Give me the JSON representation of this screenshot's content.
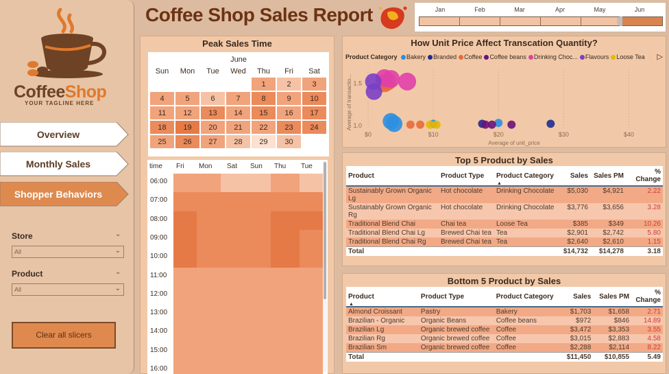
{
  "app": {
    "title": "Coffee Shop Sales Report",
    "logo_word1": "Coffee",
    "logo_word2": "Shop",
    "tagline": "YOUR TAGLINE HERE"
  },
  "nav": [
    {
      "label": "Overview",
      "active": false
    },
    {
      "label": "Monthly Sales",
      "active": false
    },
    {
      "label": "Shopper Behaviors",
      "active": true
    }
  ],
  "slicers": {
    "store_label": "Store",
    "store_value": "All",
    "product_label": "Product",
    "product_value": "All",
    "clear_label": "Clear all slicers"
  },
  "months": {
    "labels": [
      "Jan",
      "Feb",
      "Mar",
      "Apr",
      "May",
      "Jun"
    ],
    "selected": "Jun"
  },
  "peak": {
    "title": "Peak Sales Time",
    "month": "June",
    "dow": [
      "Sun",
      "Mon",
      "Tue",
      "Wed",
      "Thu",
      "Fri",
      "Sat"
    ],
    "days": [
      {
        "d": "1",
        "level": 2
      },
      {
        "d": "2",
        "level": 1
      },
      {
        "d": "3",
        "level": 2
      },
      {
        "d": "4",
        "level": 2
      },
      {
        "d": "5",
        "level": 2
      },
      {
        "d": "6",
        "level": 1
      },
      {
        "d": "7",
        "level": 2
      },
      {
        "d": "8",
        "level": 3
      },
      {
        "d": "9",
        "level": 2
      },
      {
        "d": "10",
        "level": 3
      },
      {
        "d": "11",
        "level": 2
      },
      {
        "d": "12",
        "level": 2
      },
      {
        "d": "13",
        "level": 3
      },
      {
        "d": "14",
        "level": 2
      },
      {
        "d": "15",
        "level": 3
      },
      {
        "d": "16",
        "level": 2
      },
      {
        "d": "17",
        "level": 3
      },
      {
        "d": "18",
        "level": 3
      },
      {
        "d": "19",
        "level": 4
      },
      {
        "d": "20",
        "level": 2
      },
      {
        "d": "21",
        "level": 2
      },
      {
        "d": "22",
        "level": 2
      },
      {
        "d": "23",
        "level": 3
      },
      {
        "d": "24",
        "level": 3
      },
      {
        "d": "25",
        "level": 2
      },
      {
        "d": "26",
        "level": 3
      },
      {
        "d": "27",
        "level": 2
      },
      {
        "d": "28",
        "level": 1
      },
      {
        "d": "29",
        "level": 0
      },
      {
        "d": "30",
        "level": 1
      }
    ],
    "heat_header": [
      "time",
      "Fri",
      "Mon",
      "Sat",
      "Sun",
      "Thu",
      "Tue"
    ],
    "times": [
      "06:00",
      "07:00",
      "08:00",
      "09:00",
      "10:00",
      "11:00",
      "12:00",
      "13:00",
      "14:00",
      "15:00",
      "16:00"
    ],
    "heat_levels": [
      [
        2,
        2,
        1,
        1,
        2,
        1
      ],
      [
        3,
        3,
        3,
        3,
        3,
        3
      ],
      [
        4,
        3,
        3,
        3,
        4,
        4
      ],
      [
        4,
        3,
        3,
        3,
        4,
        3
      ],
      [
        4,
        3,
        3,
        3,
        4,
        3
      ],
      [
        2,
        2,
        2,
        2,
        2,
        2
      ],
      [
        2,
        2,
        2,
        2,
        2,
        2
      ],
      [
        2,
        2,
        2,
        2,
        2,
        2
      ],
      [
        2,
        2,
        2,
        2,
        2,
        2
      ],
      [
        2,
        2,
        2,
        2,
        2,
        2
      ],
      [
        2,
        2,
        2,
        2,
        2,
        2
      ]
    ],
    "heat_colors": [
      "#fde0cf",
      "#f6c2a5",
      "#f1a37b",
      "#eb8a5b",
      "#e57a46"
    ]
  },
  "scatter": {
    "title": "How Unit Price Affect Transcation Quantity?",
    "legend_title": "Product Category",
    "legend": [
      {
        "name": "Bakery",
        "color": "#2d8fe0"
      },
      {
        "name": "Branded",
        "color": "#1f2d8f"
      },
      {
        "name": "Coffee",
        "color": "#e86a3a"
      },
      {
        "name": "Coffee beans",
        "color": "#6b127a"
      },
      {
        "name": "Drinking Choc...",
        "color": "#e040a8"
      },
      {
        "name": "Flavours",
        "color": "#7a3fc8"
      },
      {
        "name": "Loose Tea",
        "color": "#e6b800"
      }
    ],
    "ylabel": "Average of transactio...",
    "xlabel": "Average of unit_price",
    "xticks": [
      "$0",
      "$10",
      "$20",
      "$30",
      "$40"
    ],
    "yticks": [
      "1.5",
      "1.0"
    ]
  },
  "chart_data": {
    "type": "scatter",
    "title": "How Unit Price Affect Transcation Quantity?",
    "xlabel": "Average of unit_price",
    "ylabel": "Average of transactio...",
    "xlim": [
      0,
      45
    ],
    "ylim": [
      0.95,
      1.6
    ],
    "series": [
      {
        "name": "Bakery",
        "points": [
          [
            3.5,
            1.05
          ],
          [
            4,
            1.02
          ],
          [
            10,
            1.02
          ],
          [
            20,
            1.03
          ]
        ]
      },
      {
        "name": "Branded",
        "points": [
          [
            17.5,
            1.02
          ],
          [
            28,
            1.02
          ]
        ]
      },
      {
        "name": "Coffee",
        "points": [
          [
            3,
            1.52
          ],
          [
            2.5,
            1.5
          ],
          [
            6.5,
            1.01
          ],
          [
            8,
            1.01
          ]
        ]
      },
      {
        "name": "Coffee beans",
        "points": [
          [
            18,
            1.01
          ],
          [
            22,
            1.01
          ],
          [
            19,
            1.01
          ]
        ]
      },
      {
        "name": "Drinking Choc...",
        "points": [
          [
            3.5,
            1.55
          ],
          [
            6,
            1.52
          ],
          [
            2.5,
            1.56
          ]
        ]
      },
      {
        "name": "Flavours",
        "points": [
          [
            0.8,
            1.52
          ],
          [
            0.9,
            1.4
          ]
        ]
      },
      {
        "name": "Loose Tea",
        "points": [
          [
            9.5,
            1.01
          ],
          [
            10.5,
            1.01
          ]
        ]
      }
    ]
  },
  "top5": {
    "title": "Top 5 Product by Sales",
    "headers": [
      "Product",
      "Product Type",
      "Product Category",
      "Sales",
      "Sales PM",
      "% Change"
    ],
    "rows": [
      [
        "Sustainably Grown Organic Lg",
        "Hot chocolate",
        "Drinking Chocolate",
        "$5,030",
        "$4,921",
        "2.22"
      ],
      [
        "Sustainably Grown Organic Rg",
        "Hot chocolate",
        "Drinking Chocolate",
        "$3,776",
        "$3,656",
        "3.28"
      ],
      [
        "Traditional Blend Chai",
        "Chai tea",
        "Loose Tea",
        "$385",
        "$349",
        "10.26"
      ],
      [
        "Traditional Blend Chai Lg",
        "Brewed Chai tea",
        "Tea",
        "$2,901",
        "$2,742",
        "5.80"
      ],
      [
        "Traditional Blend Chai Rg",
        "Brewed Chai tea",
        "Tea",
        "$2,640",
        "$2,610",
        "1.15"
      ]
    ],
    "total": [
      "Total",
      "",
      "",
      "$14,732",
      "$14,278",
      "3.18"
    ]
  },
  "bottom5": {
    "title": "Bottom 5 Product by Sales",
    "headers": [
      "Product",
      "Product Type",
      "Product Category",
      "Sales",
      "Sales PM",
      "% Change"
    ],
    "rows": [
      [
        "Almond Croissant",
        "Pastry",
        "Bakery",
        "$1,703",
        "$1,658",
        "2.71"
      ],
      [
        "Brazilian - Organic",
        "Organic Beans",
        "Coffee beans",
        "$972",
        "$846",
        "14.89"
      ],
      [
        "Brazilian Lg",
        "Organic brewed coffee",
        "Coffee",
        "$3,472",
        "$3,353",
        "3.55"
      ],
      [
        "Brazilian Rg",
        "Organic brewed coffee",
        "Coffee",
        "$3,015",
        "$2,883",
        "4.58"
      ],
      [
        "Brazilian Sm",
        "Organic brewed coffee",
        "Coffee",
        "$2,288",
        "$2,114",
        "8.22"
      ]
    ],
    "total": [
      "Total",
      "",
      "",
      "$11,450",
      "$10,855",
      "5.49"
    ]
  }
}
